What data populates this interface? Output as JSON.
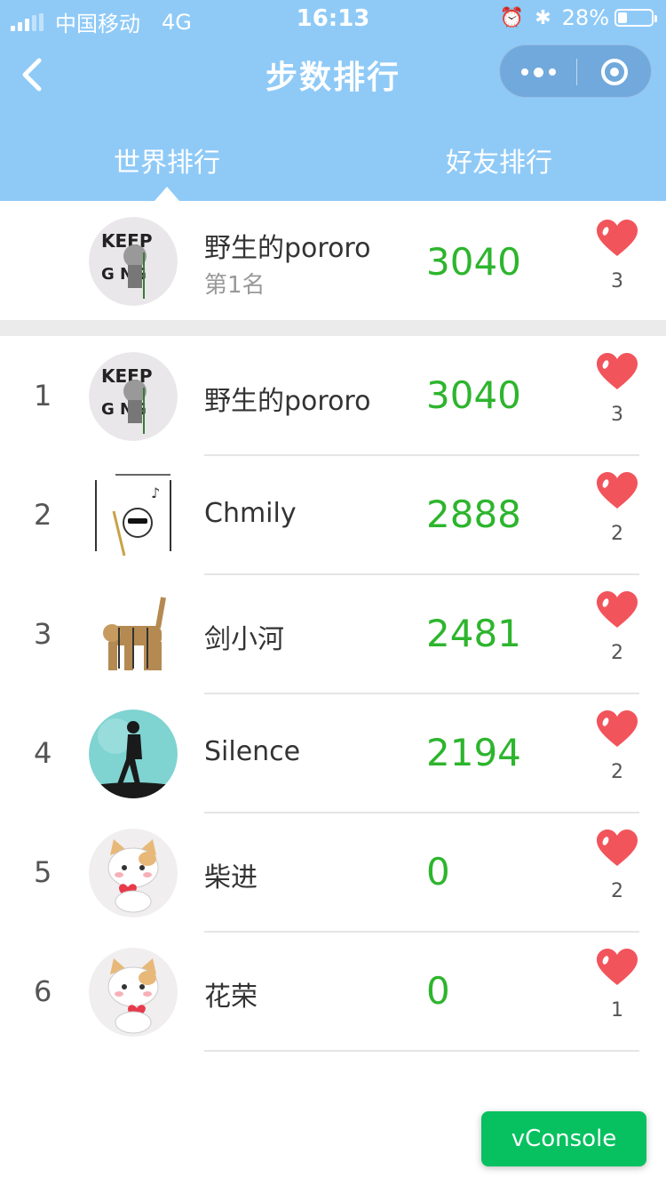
{
  "status_bar": {
    "carrier": "中国移动",
    "network": "4G",
    "time": "16:13",
    "battery": "28%"
  },
  "nav": {
    "title": "步数排行"
  },
  "tabs": [
    {
      "label": "世界排行",
      "active": true
    },
    {
      "label": "好友排行",
      "active": false
    }
  ],
  "me": {
    "name": "野生的pororo",
    "position_text": "第1名",
    "steps": "3040",
    "likes": "3"
  },
  "rankings": [
    {
      "rank": "1",
      "name": "野生的pororo",
      "steps": "3040",
      "likes": "3"
    },
    {
      "rank": "2",
      "name": "Chmily",
      "steps": "2888",
      "likes": "2"
    },
    {
      "rank": "3",
      "name": "剑小河",
      "steps": "2481",
      "likes": "2"
    },
    {
      "rank": "4",
      "name": "Silence",
      "steps": "2194",
      "likes": "2"
    },
    {
      "rank": "5",
      "name": "柴进",
      "steps": "0",
      "likes": "2"
    },
    {
      "rank": "6",
      "name": "花荣",
      "steps": "0",
      "likes": "1"
    }
  ],
  "vconsole_label": "vConsole",
  "colors": {
    "header": "#8fcaf7",
    "steps": "#2db52d",
    "heart": "#f2545b",
    "vconsole": "#07c160"
  }
}
